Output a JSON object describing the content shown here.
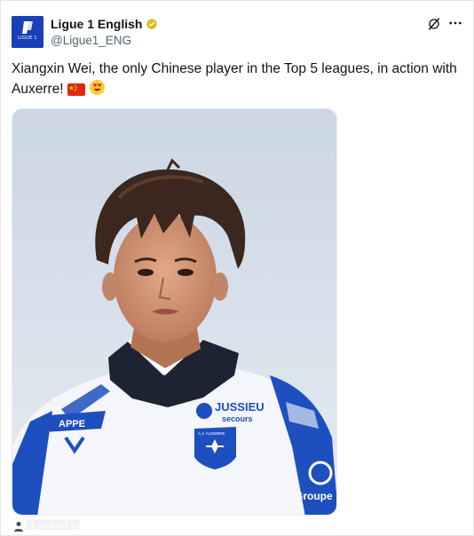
{
  "account": {
    "display_name": "Ligue 1 English",
    "handle": "@Ligue1_ENG",
    "avatar_logo_text": "LIGUE 1",
    "avatar_logo_mark": "l1-logo-icon",
    "verified_badge": "verified-gold-badge",
    "brand_color": "#1a3fb8",
    "badge_color": "#e2b719"
  },
  "header_actions": {
    "grok_icon": "grok-icon",
    "more_icon": "more-horizontal-icon"
  },
  "tweet": {
    "text": "Xiangxin Wei, the only Chinese player in the Top 5 leagues, in action with Auxerre!",
    "emojis": [
      "china-flag-emoji",
      "heart-eyes-emoji"
    ]
  },
  "media": {
    "description_icon": "photo-player-auxerre",
    "jersey_sponsor": "JUSSIEU",
    "jersey_sponsor_sub": "secours",
    "jersey_sleeve_sponsor": "Groupe",
    "jersey_chest_left": "APPE",
    "club_crest_text": "A.J. AUXERRE",
    "sky_color": "#d7dfea",
    "kit_blue": "#1e4fbf"
  },
  "footer": {
    "icon": "person-icon",
    "watermark": "░░░░░░░░"
  }
}
